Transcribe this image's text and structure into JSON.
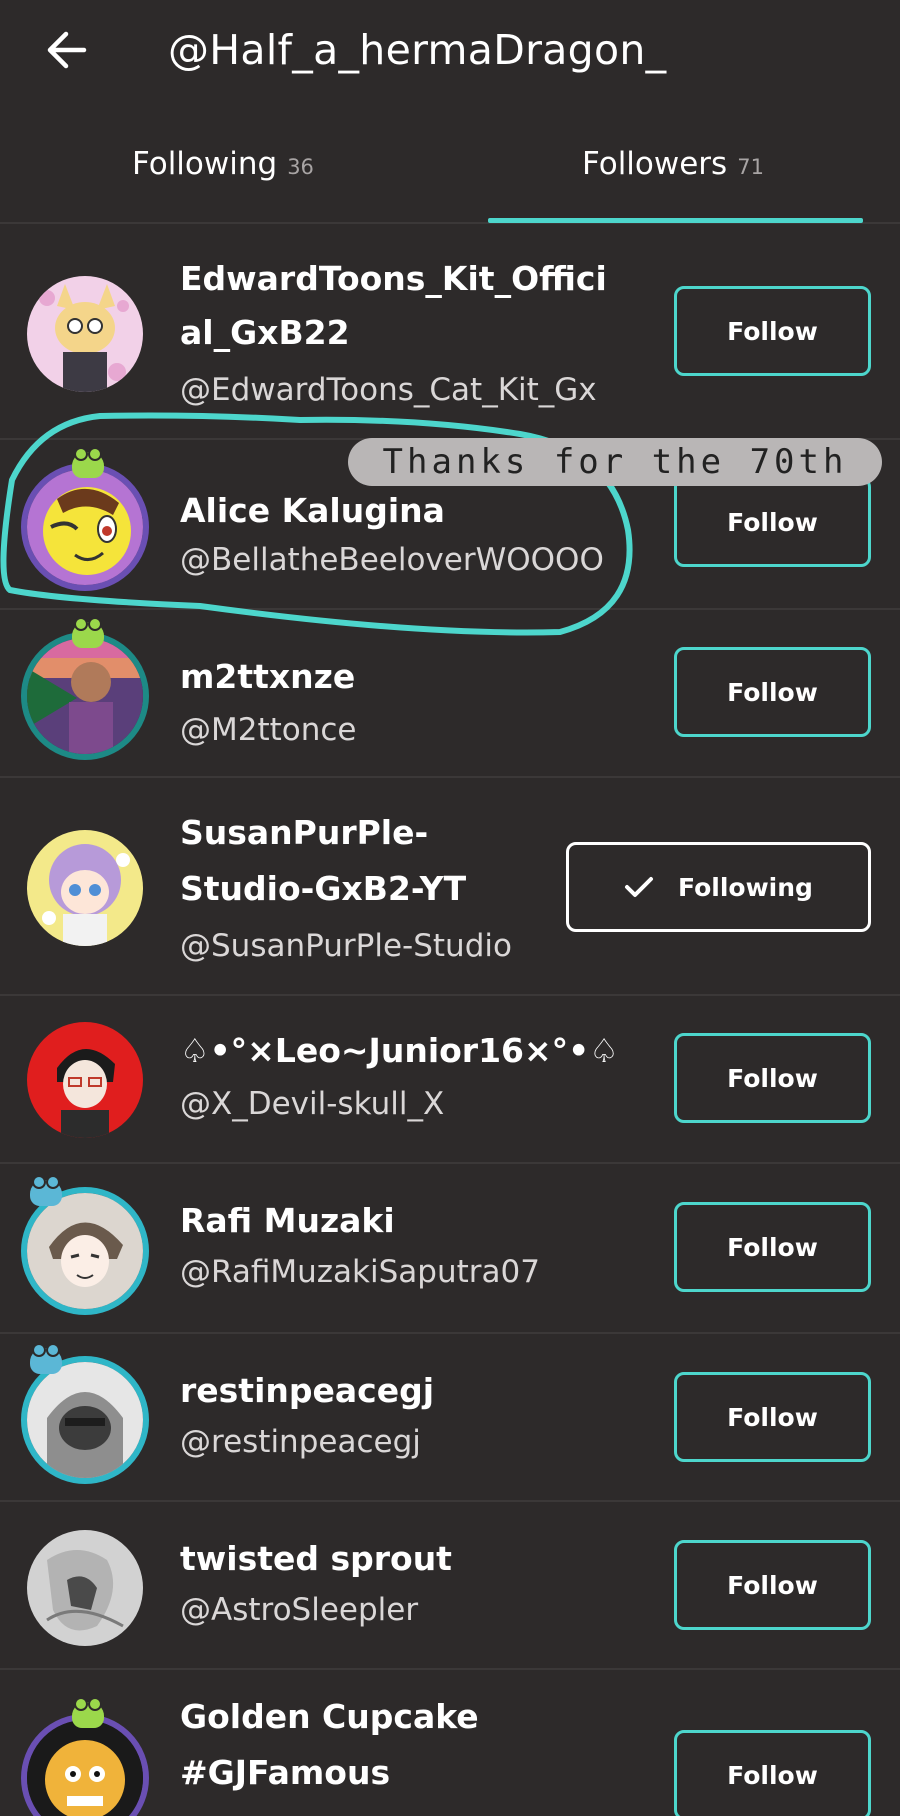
{
  "header": {
    "back_label": "←",
    "title": "@Half_a_hermaDragon_"
  },
  "tabs": [
    {
      "label": "Following",
      "count": "36",
      "selected": false
    },
    {
      "label": "Followers",
      "count": "71",
      "selected": true
    }
  ],
  "accent_color": "#4dd6cc",
  "overlay_text": "Thanks for the 70th",
  "followers": [
    {
      "name": "EdwardToons_Kit_Offici",
      "name2": "al_GxB22",
      "handle": "@EdwardToons_Cat_Kit_Gx",
      "button": "Follow"
    },
    {
      "name": "Alice Kalugina",
      "handle": "@BellatheBeeloverWOOOO",
      "button": "Follow"
    },
    {
      "name": "m2ttxnze",
      "handle": "@M2ttonce",
      "button": "Follow"
    },
    {
      "name": "SusanPurPle-",
      "name2": "Studio-GxB2-YT",
      "handle": "@SusanPurPle-Studio",
      "button": "Following"
    },
    {
      "name": "♤•°×Leo~Junior16×°•♤",
      "handle": "@X_Devil-skull_X",
      "button": "Follow"
    },
    {
      "name": "Rafi Muzaki",
      "handle": "@RafiMuzakiSaputra07",
      "button": "Follow"
    },
    {
      "name": "restinpeacegj",
      "handle": "@restinpeacegj",
      "button": "Follow"
    },
    {
      "name": "twisted sprout",
      "handle": "@AstroSleepler",
      "button": "Follow"
    },
    {
      "name": "Golden Cupcake",
      "name2": "#GJFamous",
      "button": "Follow"
    }
  ]
}
